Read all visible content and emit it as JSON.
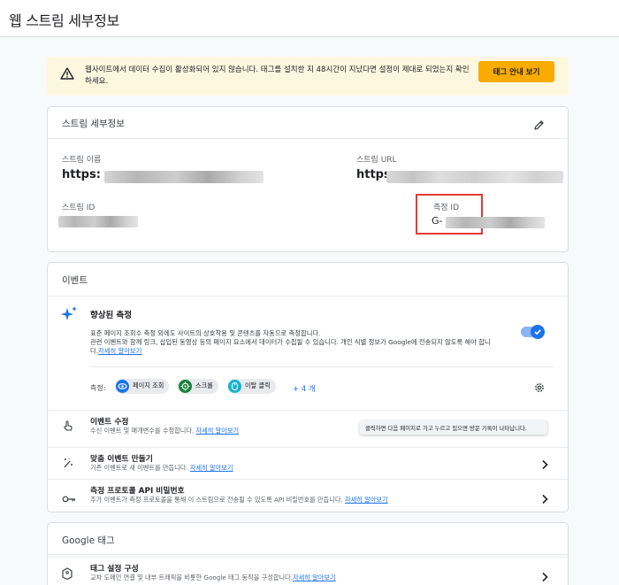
{
  "page": {
    "title": "웹 스트림 세부정보"
  },
  "banner": {
    "message": "웹사이트에서 데이터 수집이 활성화되어 있지 않습니다. 태그를 설치한 지 48시간이 지났다면 설정이 제대로 되었는지 확인하세요.",
    "button_label": "태그 안내 보기",
    "icon": "warning-icon"
  },
  "stream_details": {
    "title": "스트림 세부정보",
    "edit_icon": "pencil-icon",
    "name_label": "스트림 이름",
    "name_value": "https:",
    "url_label": "스트림 URL",
    "url_value": "https",
    "id_label": "스트림 ID",
    "measurement_label": "측정 ID",
    "measurement_value": "G-"
  },
  "events": {
    "title": "이벤트",
    "enhanced": {
      "title": "향상된 측정",
      "desc_line1": "표준 페이지 조회수 측정 외에도 사이트의 상호작용 및 콘텐츠를 자동으로 측정합니다.",
      "desc_line2": "관련 이벤트와 함께 링크, 삽입된 동영상 등의 페이지 요소에서 데이터가 수집될 수 있습니다. 개인 식별 정보가 Google에 전송되지 않도록 해야 합니",
      "desc_line3_prefix": "다.",
      "learn_more": "자세히 알아보기",
      "enabled": true
    },
    "measuring_label": "측정:",
    "chips": [
      {
        "label": "페이지 조회",
        "icon": "eye-icon",
        "color": "#1a73e8"
      },
      {
        "label": "스크롤",
        "icon": "crosshair-icon",
        "color": "#188038"
      },
      {
        "label": "이탈 클릭",
        "icon": "cursor-click-icon",
        "color": "#12b5cb"
      }
    ],
    "more_label": "+ 4 개",
    "rows": [
      {
        "title": "이벤트 수정",
        "sub": "수신 이벤트 및 매개변수를 수정합니다.",
        "link": "자세히 알아보기",
        "icon": "touch-icon"
      },
      {
        "title": "맞춤 이벤트 만들기",
        "sub": "기존 이벤트로 새 이벤트를 만듭니다.",
        "link": "자세히 알아보기",
        "icon": "sparkle-icon"
      },
      {
        "title": "측정 프로토콜 API 비밀번호",
        "sub": "추가 이벤트가 측정 프로토콜을 통해 이 스트림으로 전송될 수 있도록 API 비밀번호를 만듭니다.",
        "link": "자세히 알아보기",
        "icon": "key-icon"
      }
    ],
    "tooltip": "클릭하면 다음 페이지로 가고 누르고 있으면 방문 기록이 나타납니다."
  },
  "google_tag": {
    "title": "Google 태그",
    "rows": [
      {
        "title": "태그 설정 구성",
        "sub": "교차 도메인 연결 및 내부 트래픽을 비롯한 Google 태그 동작을 구성합니다.",
        "link": "자세히 알아보기",
        "icon": "tag-icon"
      }
    ]
  }
}
